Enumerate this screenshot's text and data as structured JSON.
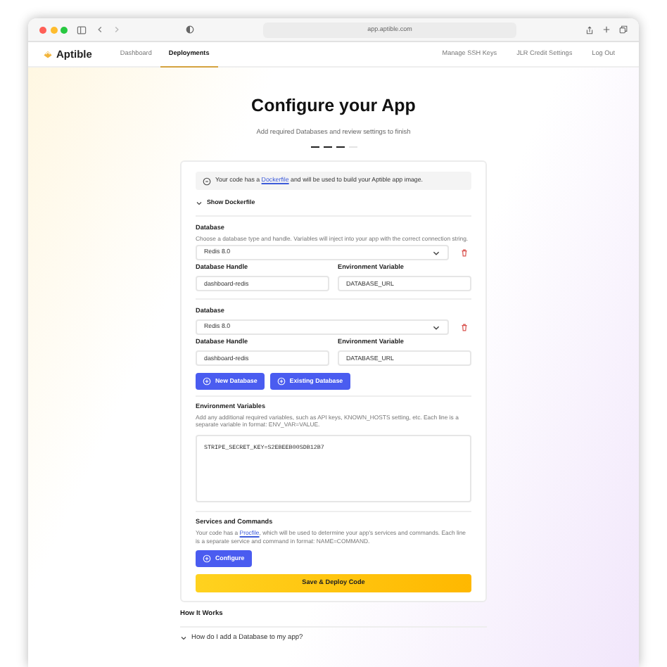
{
  "browser": {
    "url": "app.aptible.com"
  },
  "nav": {
    "brand": "Aptible",
    "links": [
      {
        "label": "Dashboard",
        "selected": false
      },
      {
        "label": "Deployments",
        "selected": true
      }
    ],
    "right_links": [
      "Manage SSH Keys",
      "JLR Credit Settings",
      "Log Out"
    ]
  },
  "header": {
    "title": "Configure your App",
    "subtitle": "Add required Databases and review settings to finish",
    "steps": [
      {
        "done": true
      },
      {
        "done": true
      },
      {
        "done": true
      },
      {
        "done": false
      }
    ]
  },
  "notice": {
    "parts": [
      "Your code has a ",
      "Dockerfile",
      " and will be used to build your Aptible app image."
    ]
  },
  "dockerfile_toggle": {
    "label": "Show Dockerfile",
    "expanded": false
  },
  "databases": [
    {
      "label": "Database",
      "description": "Choose a database type and handle. Variables will inject into your app with the correct connection string.",
      "type": "Redis 8.0",
      "handle_label": "Database Handle",
      "handle": "dashboard-redis",
      "env_label": "Environment Variable",
      "env": "DATABASE_URL"
    },
    {
      "label": "Database",
      "type": "Redis 8.0",
      "handle_label": "Database Handle",
      "handle": "dashboard-redis",
      "env_label": "Environment Variable",
      "env": "DATABASE_URL"
    }
  ],
  "database_buttons": [
    "New Database",
    "Existing Database"
  ],
  "env_vars": {
    "label": "Environment Variables",
    "description": "Add any additional required variables, such as API keys, KNOWN_HOSTS setting, etc. Each line is a separate variable in format: ENV_VAR=VALUE.",
    "value": "STRIPE_SECRET_KEY=S2EBEEB00SDB12B7"
  },
  "services": {
    "label": "Services and Commands",
    "parts": [
      "Your code has a ",
      "Procfile",
      ", which will be used to determine your app's services and commands. Each line is a separate service and command in format: NAME=COMMAND."
    ],
    "button": "Configure"
  },
  "submit": "Save & Deploy Code",
  "how_it_works": {
    "title": "How It Works",
    "questions": [
      {
        "text": "How do I add a Database to my app?",
        "expanded": false
      }
    ]
  }
}
